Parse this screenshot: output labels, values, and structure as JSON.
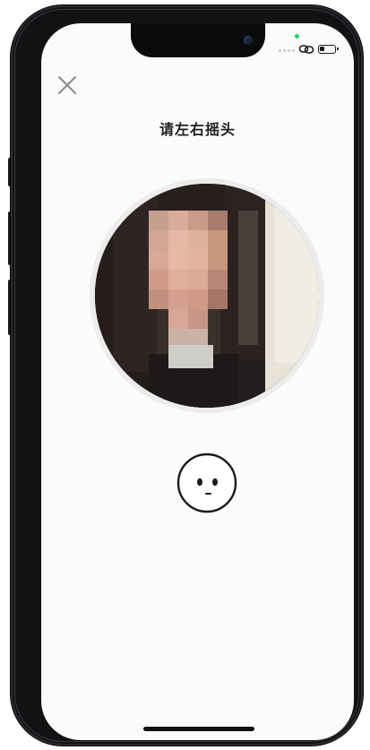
{
  "screen": {
    "title": "请左右摇头"
  },
  "icons": {
    "close": "close-icon",
    "face_hint": "face-icon",
    "link": "link-icon",
    "battery": "battery-icon"
  },
  "colors": {
    "privacy_indicator": "#2fd158",
    "title_text": "#1f1f1f",
    "ring": "#ececec"
  }
}
